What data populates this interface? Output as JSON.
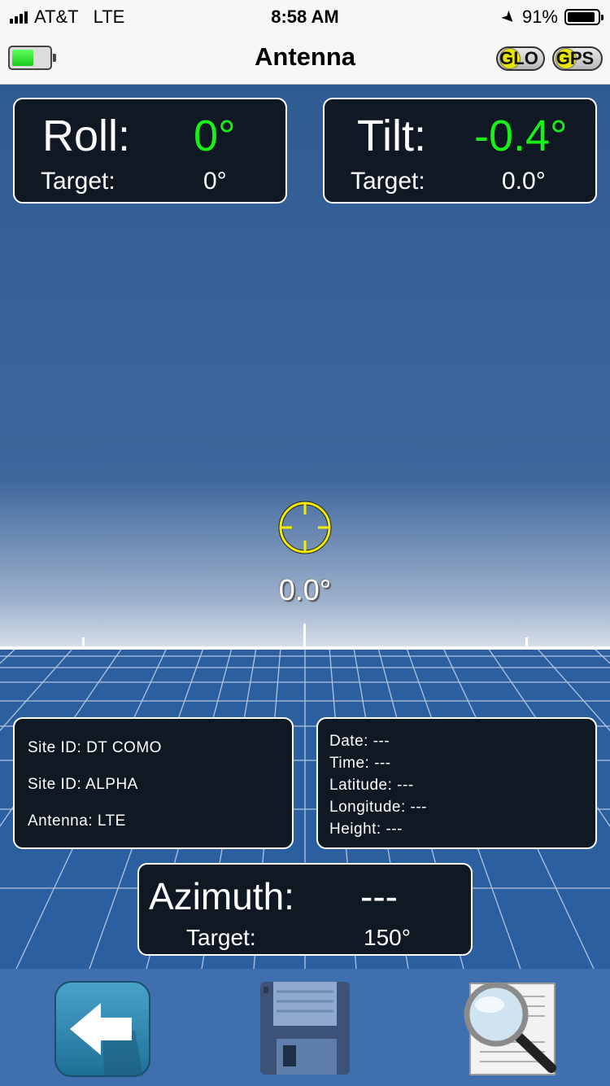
{
  "status_bar": {
    "carrier": "AT&T",
    "network": "LTE",
    "time": "8:58 AM",
    "battery_percent": "91%",
    "battery_level": 0.91
  },
  "nav": {
    "title": "Antenna",
    "app_battery_level": 0.6,
    "badges": [
      "GLO",
      "GPS"
    ]
  },
  "roll": {
    "label": "Roll:",
    "value": "0°",
    "target_label": "Target:",
    "target_value": "0°"
  },
  "tilt": {
    "label": "Tilt:",
    "value": "-0.4°",
    "target_label": "Target:",
    "target_value": "0.0°"
  },
  "horizon": {
    "value": "0.0°"
  },
  "site": {
    "line1": "Site ID: DT COMO",
    "line2": "Site ID: ALPHA",
    "line3": "Antenna: LTE"
  },
  "gps_info": {
    "date": "Date: ---",
    "time": "Time: ---",
    "latitude": "Latitude: ---",
    "longitude": "Longitude: ---",
    "height": "Height: ---"
  },
  "azimuth": {
    "label": "Azimuth:",
    "value": "---",
    "target_label": "Target:",
    "target_value": "150°"
  },
  "toolbar": {
    "icons": [
      "back-arrow-icon",
      "floppy-disk-save-icon",
      "magnifier-document-icon"
    ]
  },
  "colors": {
    "value_green": "#19f01a",
    "crosshair_yellow": "#f1ec00",
    "panel_bg": "#101923",
    "sky": "#2f5b93",
    "ground": "#2c5fa0"
  }
}
